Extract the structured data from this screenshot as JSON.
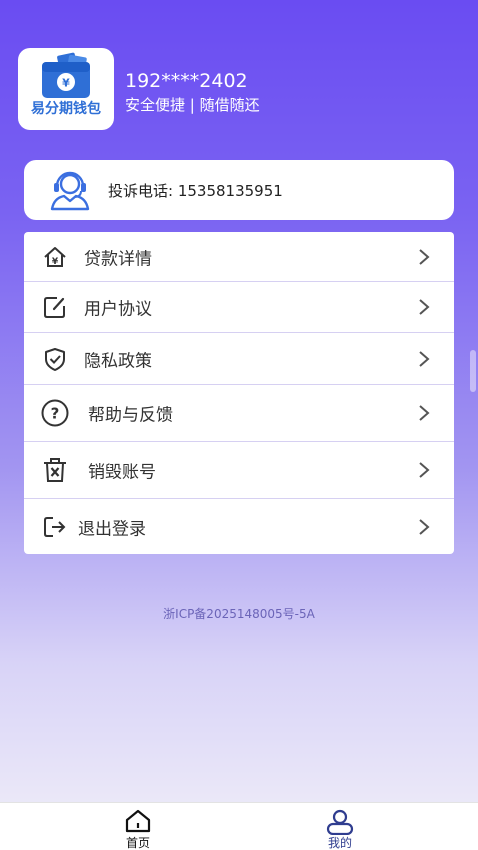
{
  "profile": {
    "app_logo_text": "易分期钱包",
    "phone": "192****2402",
    "slogan": "安全便捷 | 随借随还"
  },
  "complaint": {
    "label": "投诉电话: 15358135951"
  },
  "menu": {
    "items": [
      {
        "label": "贷款详情",
        "icon": "home-yen-icon"
      },
      {
        "label": "用户协议",
        "icon": "edit-doc-icon"
      },
      {
        "label": "隐私政策",
        "icon": "shield-check-icon"
      },
      {
        "label": "帮助与反馈",
        "icon": "question-icon"
      },
      {
        "label": "销毁账号",
        "icon": "trash-x-icon"
      },
      {
        "label": "退出登录",
        "icon": "logout-icon"
      }
    ]
  },
  "footer": {
    "icp": "浙ICP备2025148005号-5A"
  },
  "tabbar": {
    "home_label": "首页",
    "mine_label": "我的",
    "active_color": "#2f3d8f"
  }
}
